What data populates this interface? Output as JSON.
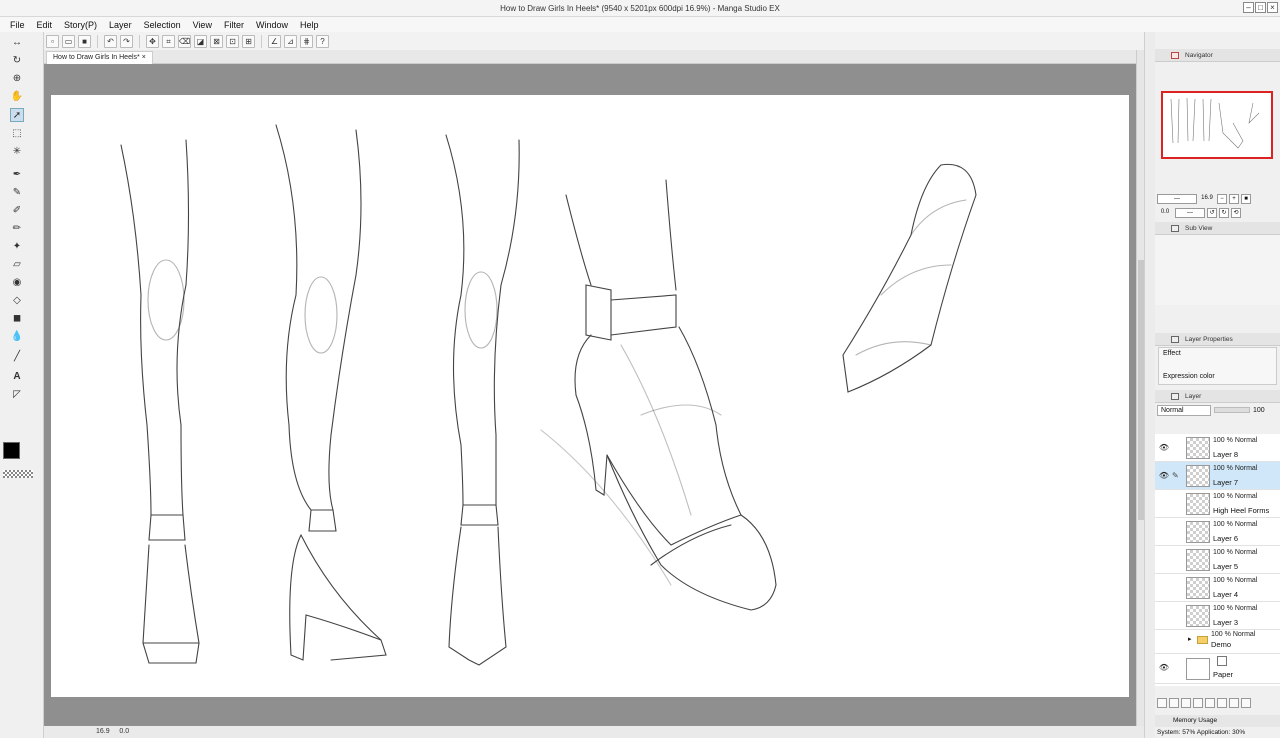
{
  "window": {
    "title": "How to Draw Girls In Heels* (9540 x 5201px 600dpi 16.9%) - Manga Studio EX"
  },
  "menu": [
    "File",
    "Edit",
    "Story(P)",
    "Layer",
    "Selection",
    "View",
    "Filter",
    "Window",
    "Help"
  ],
  "document": {
    "tab_label": "How to Draw Girls In Heels*",
    "zoom": "16.9",
    "angle": "0.0"
  },
  "navigator": {
    "title": "Navigator",
    "zoom": "16.9",
    "angle": "0.0"
  },
  "subview": {
    "title": "Sub View"
  },
  "layer_properties": {
    "title": "Layer Properties",
    "effect_label": "Effect",
    "expression_label": "Expression color"
  },
  "layer_panel": {
    "title": "Layer",
    "blend_mode": "Normal",
    "opacity": "100",
    "layers": [
      {
        "name": "Layer 8",
        "opacity": "100 %",
        "mode": "Normal",
        "visible": true,
        "selected": false
      },
      {
        "name": "Layer 7",
        "opacity": "100 %",
        "mode": "Normal",
        "visible": true,
        "selected": true
      },
      {
        "name": "High Heel Forms",
        "opacity": "100 %",
        "mode": "Normal",
        "visible": false,
        "selected": false
      },
      {
        "name": "Layer 6",
        "opacity": "100 %",
        "mode": "Normal",
        "visible": false,
        "selected": false
      },
      {
        "name": "Layer 5",
        "opacity": "100 %",
        "mode": "Normal",
        "visible": false,
        "selected": false
      },
      {
        "name": "Layer 4",
        "opacity": "100 %",
        "mode": "Normal",
        "visible": false,
        "selected": false
      },
      {
        "name": "Layer 3",
        "opacity": "100 %",
        "mode": "Normal",
        "visible": false,
        "selected": false
      }
    ],
    "folder": {
      "name": "Demo",
      "opacity": "100 %",
      "mode": "Normal"
    },
    "paper": {
      "name": "Paper"
    }
  },
  "memory": {
    "title": "Memory Usage",
    "status": "System: 57%  Application: 30%"
  },
  "colors": {
    "selection": "#cfe7f8",
    "navigator_frame": "#dd2222"
  }
}
